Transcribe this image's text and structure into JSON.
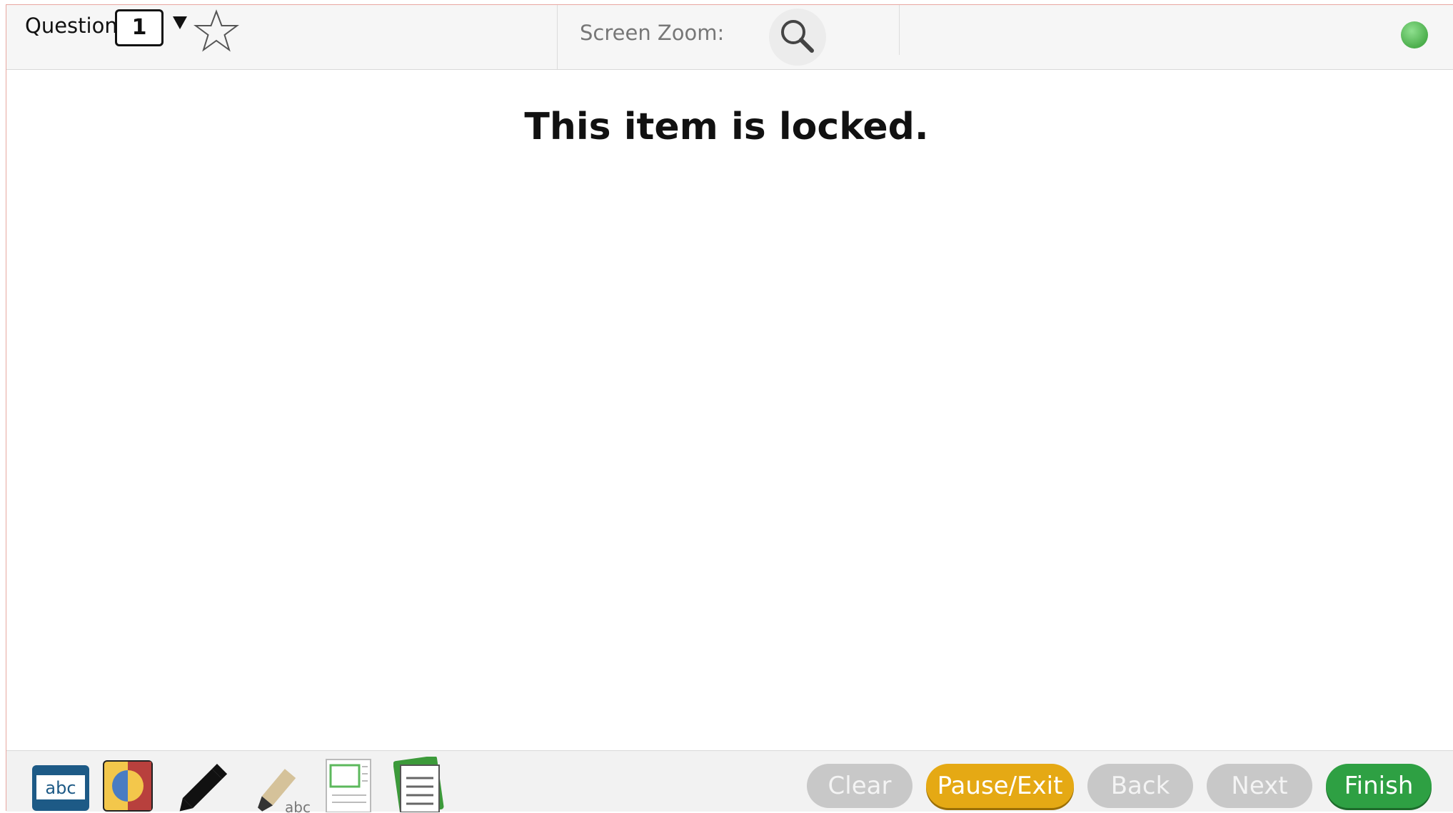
{
  "header": {
    "question_label": "Question",
    "question_number": "1",
    "zoom_label": "Screen Zoom:",
    "status_color": "#4cae4c"
  },
  "main": {
    "message": "This item is locked."
  },
  "toolbar": {
    "tools": [
      {
        "name": "line-reader-icon",
        "label": "abc"
      },
      {
        "name": "contrast-icon"
      },
      {
        "name": "pencil-icon"
      },
      {
        "name": "highlighter-icon",
        "label": "abc"
      },
      {
        "name": "notes-icon"
      },
      {
        "name": "notepad-icon"
      }
    ]
  },
  "nav": {
    "clear_label": "Clear",
    "pause_label": "Pause/Exit",
    "back_label": "Back",
    "next_label": "Next",
    "finish_label": "Finish",
    "pause_color": "#e5a914",
    "finish_color": "#2ea043",
    "disabled_color": "#c8c8c8"
  }
}
